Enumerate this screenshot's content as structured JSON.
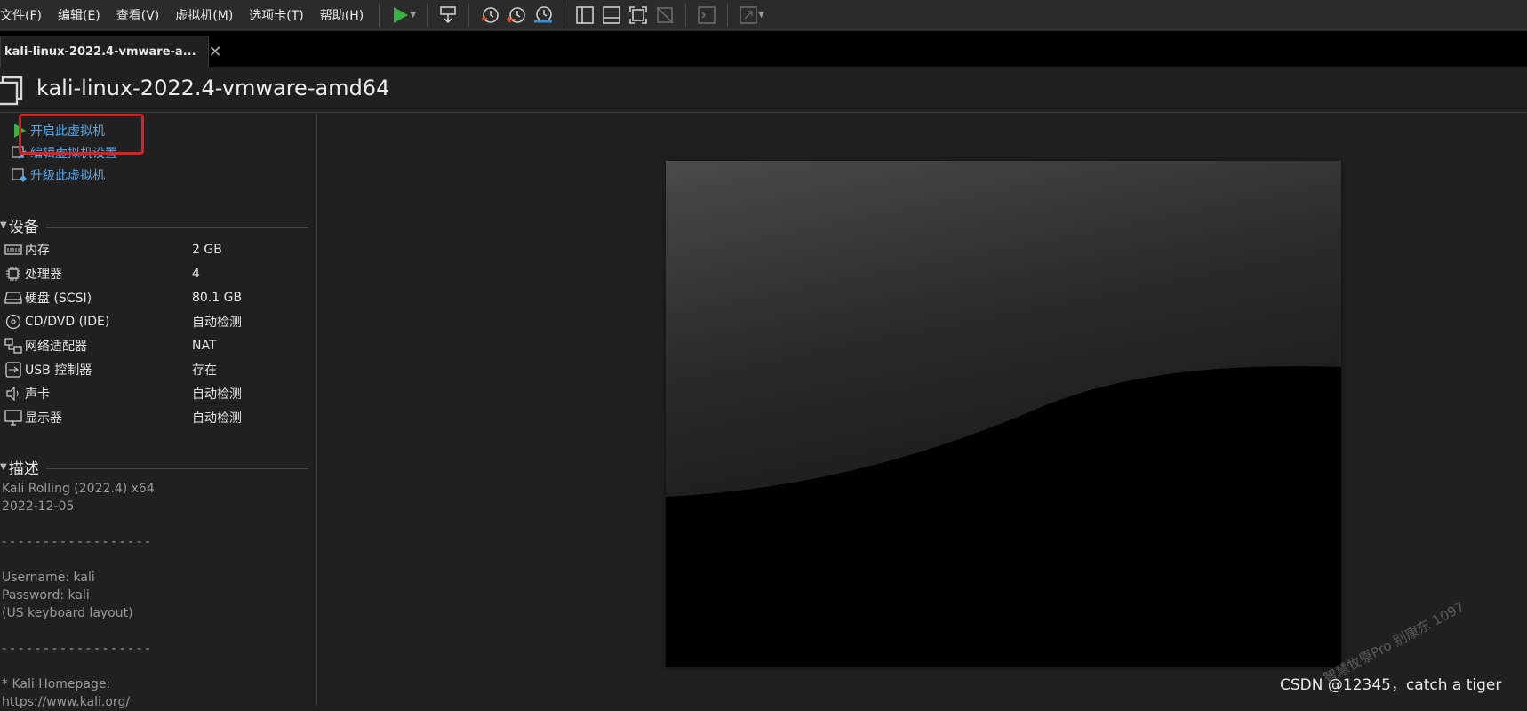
{
  "menubar": {
    "items": [
      "文件(F)",
      "编辑(E)",
      "查看(V)",
      "虚拟机(M)",
      "选项卡(T)",
      "帮助(H)"
    ]
  },
  "toolbar": {
    "icons": [
      "play-icon",
      "send-ctrl-alt-del-icon",
      "snapshot-icon",
      "revert-snapshot-icon",
      "snapshot-manager-icon",
      "library-view-icon",
      "thumbnail-view-icon",
      "fullscreen-icon",
      "unity-icon",
      "console-icon",
      "stretch-icon"
    ],
    "colors": {
      "play": "#3cb043",
      "revert": "#e0552b",
      "manager": "#3a8fd8"
    }
  },
  "tab": {
    "title": "kali-linux-2022.4-vmware-a...",
    "close": "✕"
  },
  "vm": {
    "title": "kali-linux-2022.4-vmware-amd64"
  },
  "actions": [
    {
      "label": "开启此虚拟机",
      "icon": "play-icon"
    },
    {
      "label": "编辑虚拟机设置",
      "icon": "edit-settings-icon"
    },
    {
      "label": "升级此虚拟机",
      "icon": "upgrade-icon"
    }
  ],
  "devices": {
    "header": "设备",
    "items": [
      {
        "name": "内存",
        "value": "2 GB",
        "icon": "memory-icon"
      },
      {
        "name": "处理器",
        "value": "4",
        "icon": "cpu-icon"
      },
      {
        "name": "硬盘 (SCSI)",
        "value": "80.1 GB",
        "icon": "harddisk-icon"
      },
      {
        "name": "CD/DVD (IDE)",
        "value": "自动检测",
        "icon": "cd-icon"
      },
      {
        "name": "网络适配器",
        "value": "NAT",
        "icon": "network-icon"
      },
      {
        "name": "USB 控制器",
        "value": "存在",
        "icon": "usb-icon"
      },
      {
        "name": "声卡",
        "value": "自动检测",
        "icon": "sound-icon"
      },
      {
        "name": "显示器",
        "value": "自动检测",
        "icon": "display-icon"
      }
    ]
  },
  "description": {
    "header": "描述",
    "lines": [
      "Kali Rolling (2022.4) x64",
      "2022-12-05",
      "",
      "- - - - - - - - - - - - - - - - - -",
      "",
      "Username: kali",
      "Password: kali",
      "(US keyboard layout)",
      "",
      "- - - - - - - - - - - - - - - - - -",
      "",
      "* Kali Homepage:",
      "https://www.kali.org/"
    ]
  },
  "watermark": {
    "csdn": "CSDN @12345，catch a tiger",
    "diagonal": "智慧牧原Pro 别康东 1097"
  },
  "colors": {
    "link": "#5aa8e6",
    "highlight": "#e02020"
  }
}
